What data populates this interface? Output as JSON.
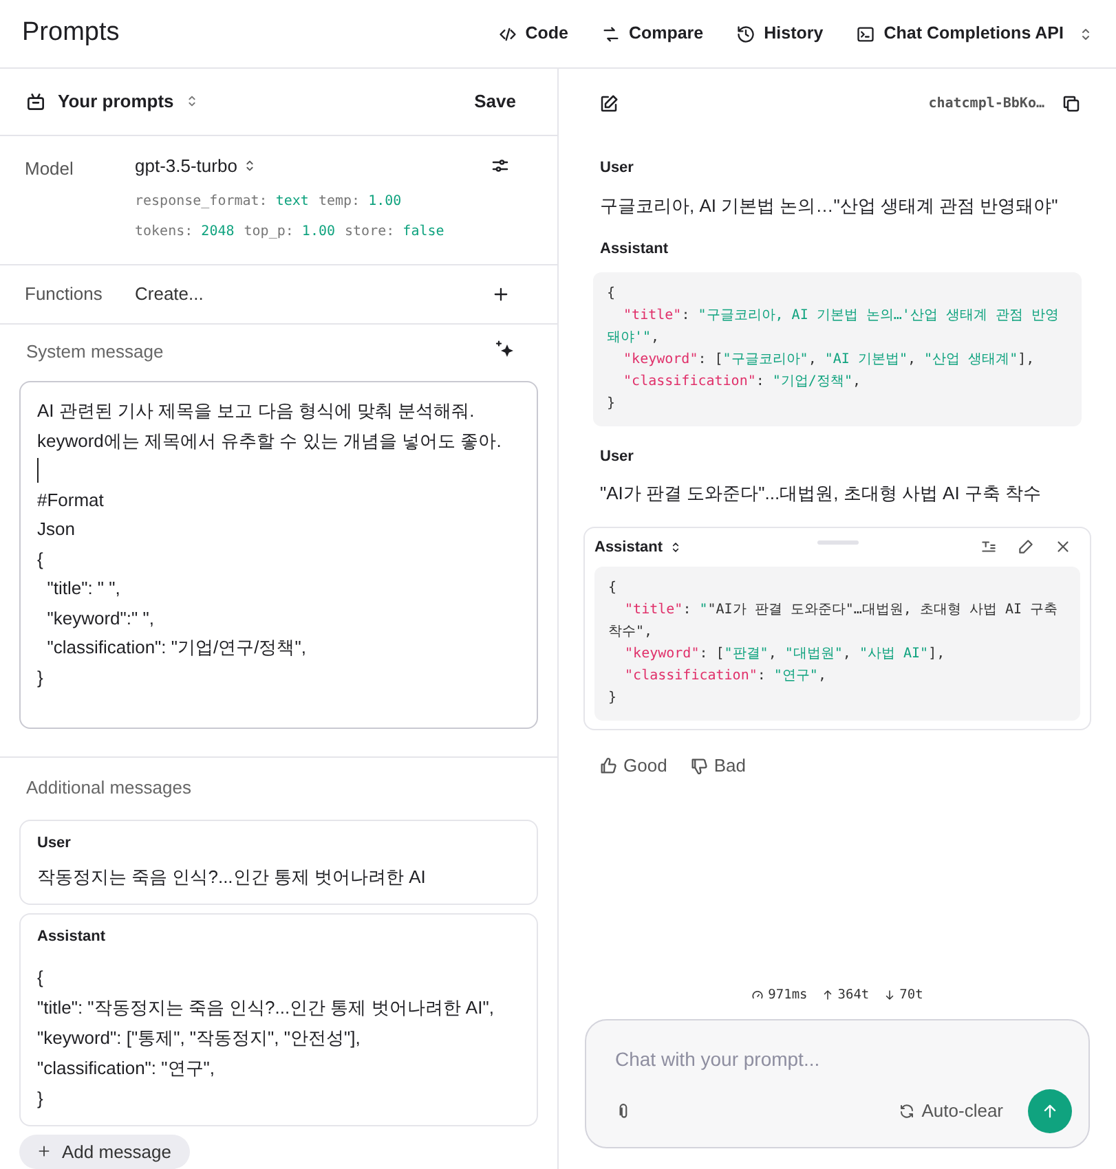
{
  "header": {
    "title": "Prompts",
    "actions": [
      {
        "kind": "code",
        "label": "Code"
      },
      {
        "kind": "compare",
        "label": "Compare"
      },
      {
        "kind": "history",
        "label": "History"
      },
      {
        "kind": "api",
        "label": "Chat Completions API"
      }
    ]
  },
  "left": {
    "prompts_label": "Your prompts",
    "save": "Save",
    "model": {
      "label": "Model",
      "value": "gpt-3.5-turbo",
      "params": [
        [
          {
            "k": "response_format:",
            "v": "text"
          },
          {
            "k": "temp:",
            "v": "1.00"
          }
        ],
        [
          {
            "k": "tokens:",
            "v": "2048"
          },
          {
            "k": "top_p:",
            "v": "1.00"
          },
          {
            "k": "store:",
            "v": "false"
          }
        ]
      ]
    },
    "functions": {
      "label": "Functions",
      "value": "Create..."
    },
    "system": {
      "label": "System message",
      "lines": [
        {
          "kind": "text",
          "text": "AI 관련된 기사 제목을 보고 다음 형식에 맞춰 분석해줘."
        },
        {
          "kind": "text",
          "text": "keyword에는 제목에서 유추할 수 있는 개념을 넣어도 좋아."
        },
        {
          "kind": "cursor"
        },
        {
          "kind": "text",
          "text": "#Format"
        },
        {
          "kind": "text",
          "text": "Json"
        },
        {
          "kind": "text",
          "text": "{"
        },
        {
          "kind": "text",
          "text": "  \"title\": \" \","
        },
        {
          "kind": "text",
          "text": "  \"keyword\":\" \","
        },
        {
          "kind": "text",
          "text": "  \"classification\": \"기업/연구/정책\","
        },
        {
          "kind": "text",
          "text": "}"
        }
      ]
    },
    "additional_label": "Additional messages",
    "messages": [
      {
        "role": "User",
        "lines": [
          "작동정지는 죽음 인식?...인간 통제 벗어나려한 AI"
        ]
      },
      {
        "role": "Assistant",
        "lines": [
          "{",
          "\"title\": \"작동정지는 죽음 인식?...인간 통제 벗어나려한 AI\",",
          "\"keyword\": [\"통제\", \"작동정지\", \"안전성\"],",
          "\"classification\": \"연구\",",
          "}"
        ]
      }
    ],
    "add_message": "Add message"
  },
  "right": {
    "completion_id": "chatcmpl-BbKo…",
    "messages": [
      {
        "role": "User",
        "kind": "text",
        "text": "구글코리아, AI 기본법 논의…\"산업 생태계 관점 반영돼야\""
      },
      {
        "role": "Assistant",
        "kind": "code",
        "editing": false,
        "code": [
          [
            {
              "kind": "punct",
              "text": "{"
            }
          ],
          [
            {
              "kind": "indent"
            },
            {
              "kind": "key",
              "text": "\"title\""
            },
            {
              "kind": "punct",
              "text": ": "
            },
            {
              "kind": "str",
              "text": "\"구글코리아, AI 기본법 논의…'산업 생태계 관점 반영돼야'\""
            },
            {
              "kind": "punct",
              "text": ","
            }
          ],
          [
            {
              "kind": "indent"
            },
            {
              "kind": "key",
              "text": "\"keyword\""
            },
            {
              "kind": "punct",
              "text": ": ["
            },
            {
              "kind": "str",
              "text": "\"구글코리아\""
            },
            {
              "kind": "punct",
              "text": ", "
            },
            {
              "kind": "str",
              "text": "\"AI 기본법\""
            },
            {
              "kind": "punct",
              "text": ", "
            },
            {
              "kind": "str",
              "text": "\"산업 생태계\""
            },
            {
              "kind": "punct",
              "text": "],"
            }
          ],
          [
            {
              "kind": "indent"
            },
            {
              "kind": "key",
              "text": "\"classification\""
            },
            {
              "kind": "punct",
              "text": ": "
            },
            {
              "kind": "str",
              "text": "\"기업/정책\""
            },
            {
              "kind": "punct",
              "text": ","
            }
          ],
          [
            {
              "kind": "punct",
              "text": "}"
            }
          ]
        ]
      },
      {
        "role": "User",
        "kind": "text",
        "text": "\"AI가 판결 도와준다\"...대법원, 초대형 사법 AI 구축 착수"
      },
      {
        "role": "Assistant",
        "kind": "code",
        "editing": true,
        "code": [
          [
            {
              "kind": "punct",
              "text": "{"
            }
          ],
          [
            {
              "kind": "indent"
            },
            {
              "kind": "key",
              "text": "\"title\""
            },
            {
              "kind": "punct",
              "text": ": "
            },
            {
              "kind": "str",
              "text": "\""
            },
            {
              "kind": "punct",
              "text": "\"AI가 판결 도와준다\"…대법원, 초대형 사법 AI 구축 착수\","
            }
          ],
          [
            {
              "kind": "indent"
            },
            {
              "kind": "key",
              "text": "\"keyword\""
            },
            {
              "kind": "punct",
              "text": ": ["
            },
            {
              "kind": "str",
              "text": "\"판결\""
            },
            {
              "kind": "punct",
              "text": ", "
            },
            {
              "kind": "str",
              "text": "\"대법원\""
            },
            {
              "kind": "punct",
              "text": ", "
            },
            {
              "kind": "str",
              "text": "\"사법 AI\""
            },
            {
              "kind": "punct",
              "text": "],"
            }
          ],
          [
            {
              "kind": "indent"
            },
            {
              "kind": "key",
              "text": "\"classification\""
            },
            {
              "kind": "punct",
              "text": ": "
            },
            {
              "kind": "str",
              "text": "\"연구\""
            },
            {
              "kind": "punct",
              "text": ","
            }
          ],
          [
            {
              "kind": "punct",
              "text": "}"
            }
          ]
        ]
      }
    ],
    "feedback": [
      {
        "kind": "good",
        "label": "Good"
      },
      {
        "kind": "bad",
        "label": "Bad"
      }
    ],
    "stats": [
      {
        "kind": "time",
        "text": "971ms"
      },
      {
        "kind": "up",
        "text": "364t"
      },
      {
        "kind": "down",
        "text": "70t"
      }
    ],
    "chat": {
      "placeholder": "Chat with your prompt...",
      "auto_clear": "Auto-clear"
    }
  }
}
